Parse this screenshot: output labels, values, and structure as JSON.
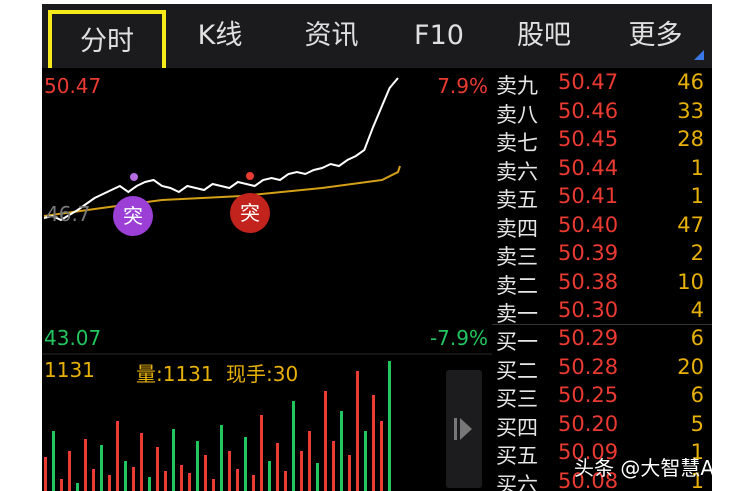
{
  "tabs": [
    {
      "label": "分时",
      "active": true
    },
    {
      "label": "K线"
    },
    {
      "label": "资讯"
    },
    {
      "label": "F10"
    },
    {
      "label": "股吧"
    },
    {
      "label": "更多"
    }
  ],
  "chart": {
    "price_high": "50.47",
    "pct_high": "7.9%",
    "price_low": "43.07",
    "pct_low": "-7.9%",
    "left_mid": "46.7",
    "badge_1": "突",
    "badge_2": "突",
    "volume_left": "1131",
    "volume_label": "量:1131",
    "hand_label": "现手:30"
  },
  "colors": {
    "up": "#ea3a32",
    "down": "#22c55e",
    "avg_line": "#d4a017",
    "price_line": "#ffffff",
    "qty": "#e7b10a",
    "active_tab_border": "#f6ea1a"
  },
  "order_book": {
    "sells": [
      {
        "side": "卖九",
        "price": "50.47",
        "qty": "46"
      },
      {
        "side": "卖八",
        "price": "50.46",
        "qty": "33"
      },
      {
        "side": "卖七",
        "price": "50.45",
        "qty": "28"
      },
      {
        "side": "卖六",
        "price": "50.44",
        "qty": "1"
      },
      {
        "side": "卖五",
        "price": "50.41",
        "qty": "1"
      },
      {
        "side": "卖四",
        "price": "50.40",
        "qty": "47"
      },
      {
        "side": "卖三",
        "price": "50.39",
        "qty": "2"
      },
      {
        "side": "卖二",
        "price": "50.38",
        "qty": "10"
      },
      {
        "side": "卖一",
        "price": "50.30",
        "qty": "4"
      }
    ],
    "buys": [
      {
        "side": "买一",
        "price": "50.29",
        "qty": "6"
      },
      {
        "side": "买二",
        "price": "50.28",
        "qty": "20"
      },
      {
        "side": "买三",
        "price": "50.25",
        "qty": "6"
      },
      {
        "side": "买四",
        "price": "50.20",
        "qty": "5"
      },
      {
        "side": "买五",
        "price": "50.09",
        "qty": "1"
      },
      {
        "side": "买六",
        "price": "50.08",
        "qty": "1"
      }
    ]
  },
  "watermark": "头条 @大智慧App"
}
